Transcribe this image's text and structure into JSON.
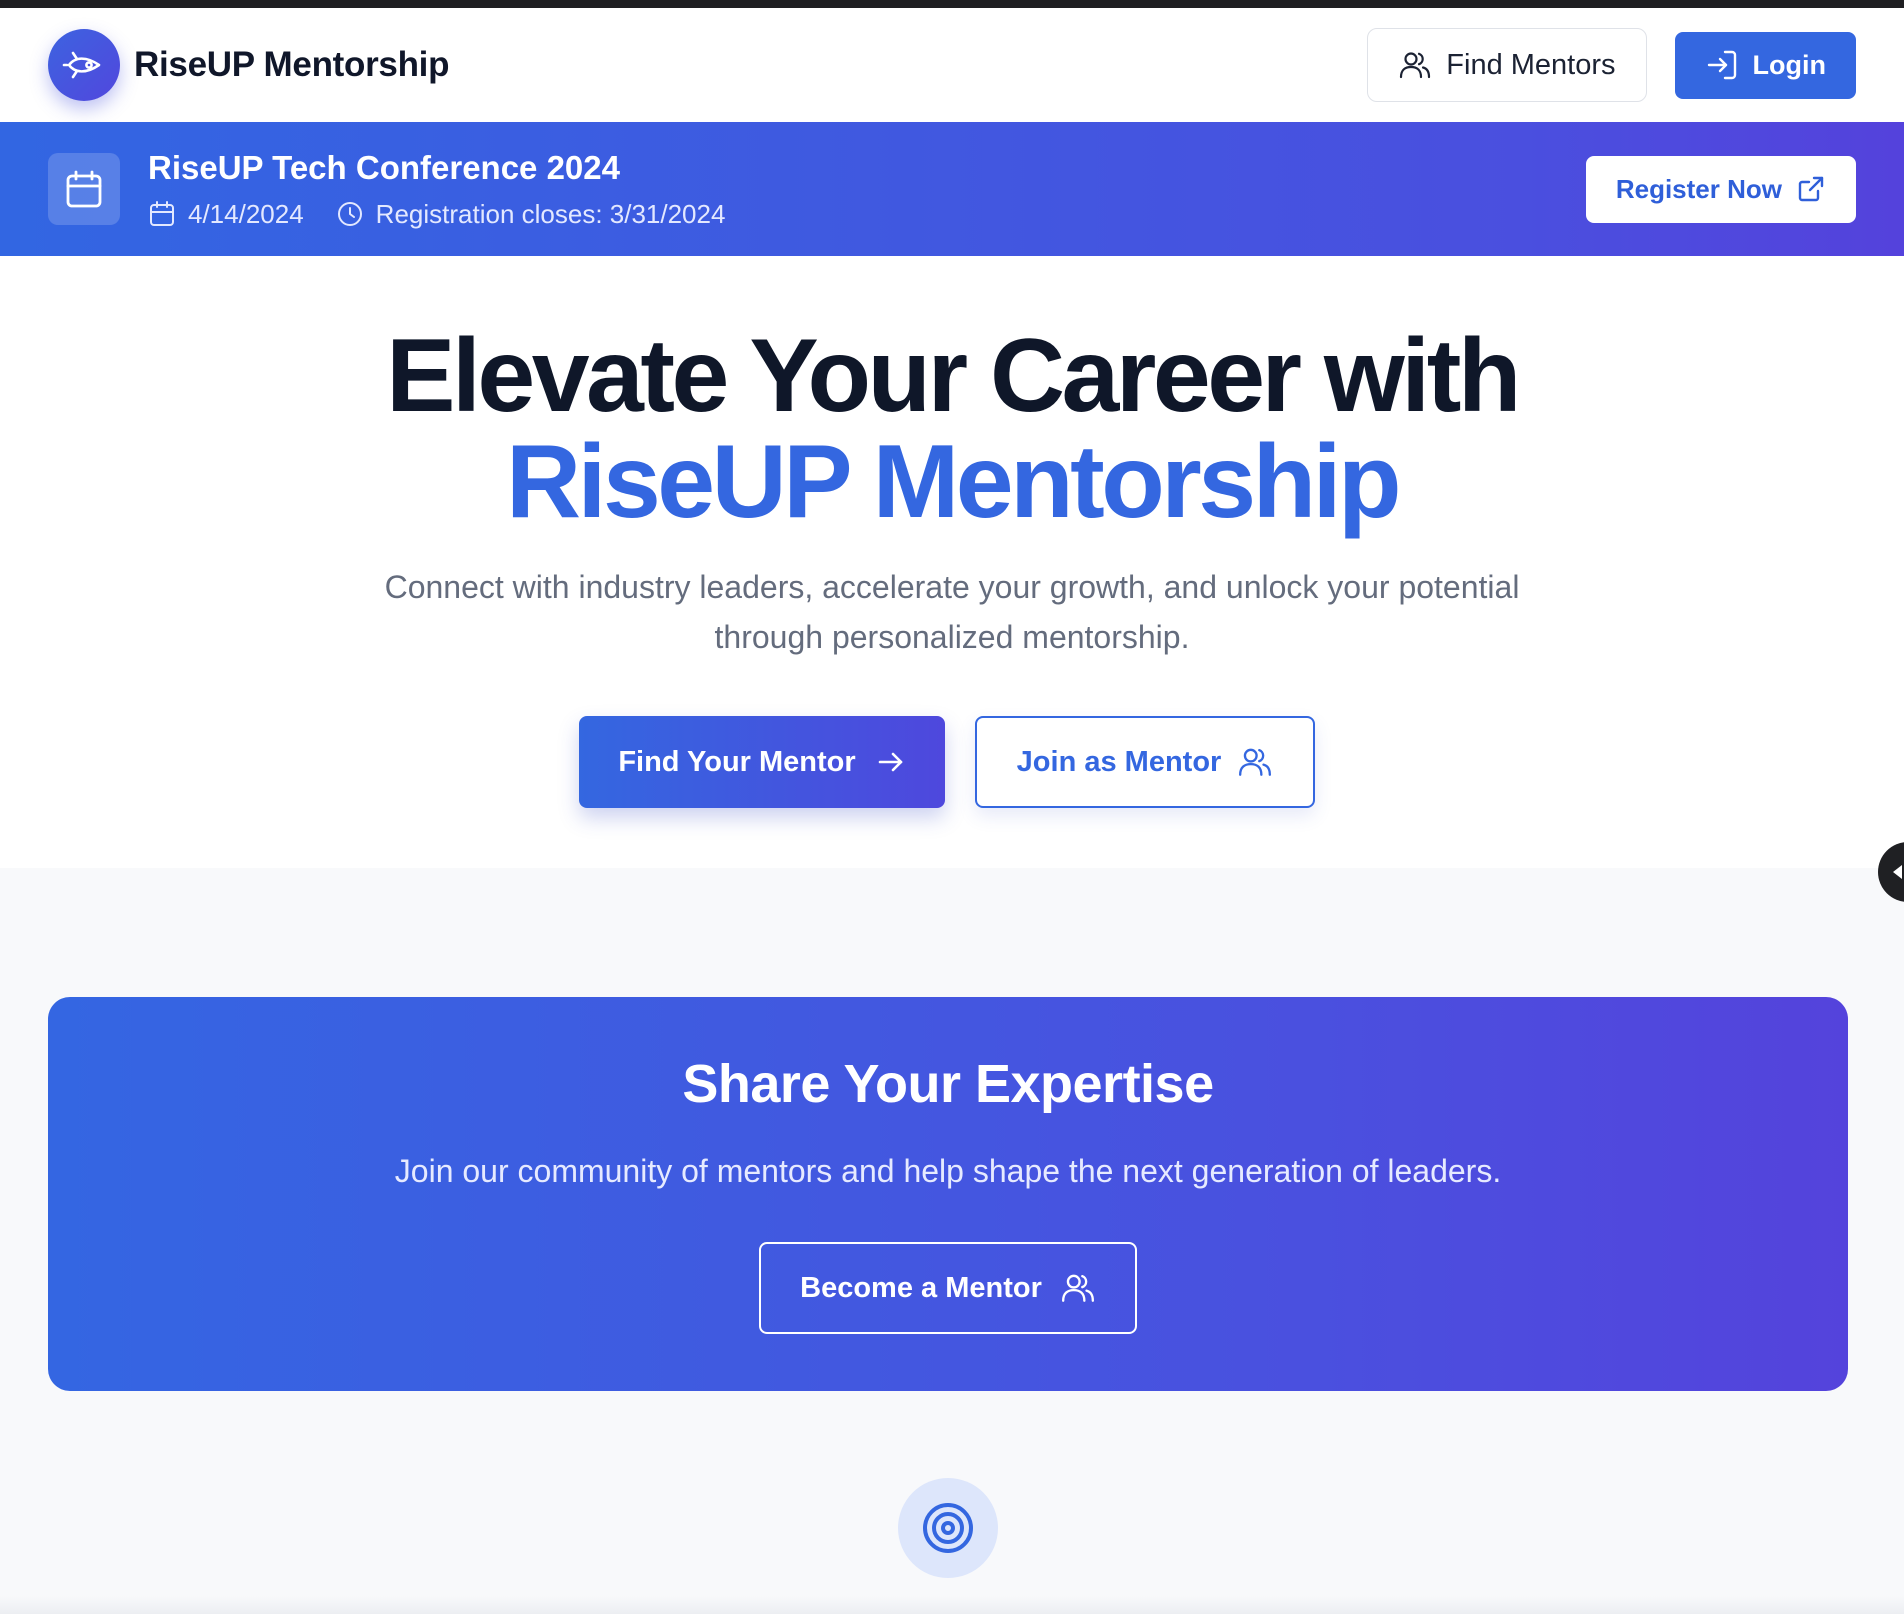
{
  "nav": {
    "brand_name": "RiseUP Mentorship",
    "brand_icon": "rocket-icon",
    "find_mentors_label": "Find Mentors",
    "login_label": "Login"
  },
  "event_banner": {
    "title": "RiseUP Tech Conference 2024",
    "date": "4/14/2024",
    "registration_closes": "Registration closes: 3/31/2024",
    "register_label": "Register Now"
  },
  "hero": {
    "headline_line1": "Elevate Your Career with",
    "headline_line2": "RiseUP Mentorship",
    "subtitle": "Connect with industry leaders, accelerate your growth, and unlock your potential through personalized mentorship.",
    "primary_cta": "Find Your Mentor",
    "secondary_cta": "Join as Mentor"
  },
  "mentor_cta": {
    "title": "Share Your Expertise",
    "subtitle": "Join our community of mentors and help shape the next generation of leaders.",
    "button_label": "Become a Mentor"
  },
  "colors": {
    "accent": "#3467e0",
    "accent_gradient_end": "#5443dc",
    "heading": "#0f1729",
    "muted_text": "#646c7d"
  },
  "icons": [
    "rocket-icon",
    "users-icon",
    "login-icon",
    "calendar-icon",
    "clock-icon",
    "external-link-icon",
    "arrow-right-icon",
    "target-icon"
  ]
}
